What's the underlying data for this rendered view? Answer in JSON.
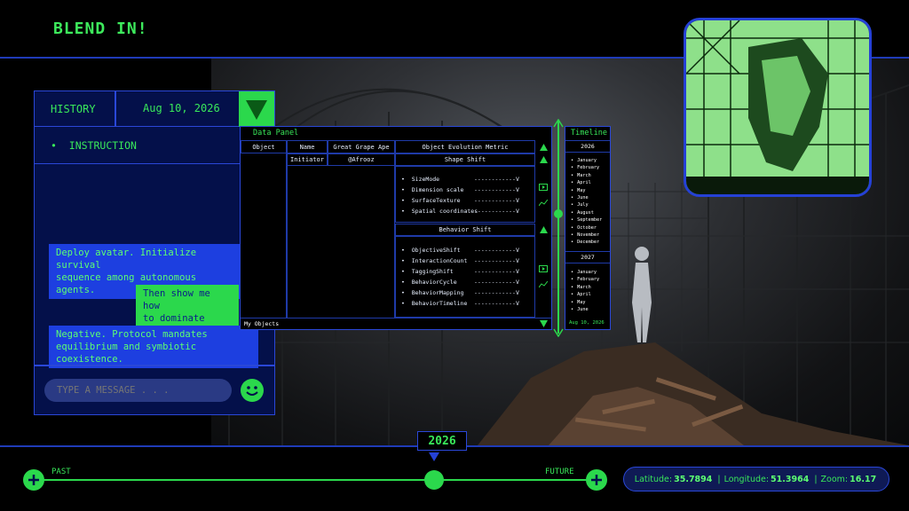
{
  "header": {
    "title": "BLEND IN!"
  },
  "history": {
    "label": "HISTORY",
    "date": "Aug 10, 2026",
    "instruction": "INSTRUCTION",
    "messages": [
      {
        "from": "system",
        "line1": "Deploy avatar. Initialize survival",
        "line2": "sequence among autonomous agents."
      },
      {
        "from": "user",
        "line1": "Then show me how",
        "line2": "to dominate first!"
      },
      {
        "from": "system",
        "line1": "Negative. Protocol mandates",
        "line2": "equilibrium and symbiotic coexistence."
      }
    ],
    "input_placeholder": "TYPE A MESSAGE . . ."
  },
  "data_panel": {
    "title": "Data Panel",
    "columns": [
      "Object",
      "Name",
      "Great Grape Ape",
      "Object Evolution Metric"
    ],
    "row": {
      "name": "Initiator",
      "value": "@Afrooz"
    },
    "groups": [
      {
        "title": "Shape Shift",
        "items": [
          "SizeMode",
          "Dimension scale",
          "SurfaceTexture",
          "Spatial coordinates"
        ]
      },
      {
        "title": "Behavior Shift",
        "items": [
          "ObjectiveShift",
          "InteractionCount",
          "TaggingShift",
          "BehaviorCycle",
          "BehaviorMapping",
          "BehaviorTimeline"
        ]
      }
    ],
    "value_marker": "------------V",
    "footer": "My Objects"
  },
  "timeline": {
    "title": "Timeline",
    "year1": "2026",
    "months1": [
      "January",
      "February",
      "March",
      "April",
      "May",
      "June",
      "July",
      "August",
      "September",
      "October",
      "November",
      "December"
    ],
    "year2": "2027",
    "months2": [
      "January",
      "February",
      "March",
      "April",
      "May",
      "June"
    ],
    "current_date": "Aug 10, 2026"
  },
  "bottom": {
    "year": "2026",
    "past_label": "PAST",
    "future_label": "FUTURE",
    "latitude_label": "Latitude:",
    "latitude": "35.7894",
    "longitude_label": "Longitude:",
    "longitude": "51.3964",
    "zoom_label": "Zoom:",
    "zoom": "16.17",
    "separator": "|"
  },
  "colors": {
    "accent_green": "#2bd84c",
    "panel_blue": "#04104a",
    "border_blue": "#2a47d8",
    "bubble_blue": "#1d3fe0"
  }
}
